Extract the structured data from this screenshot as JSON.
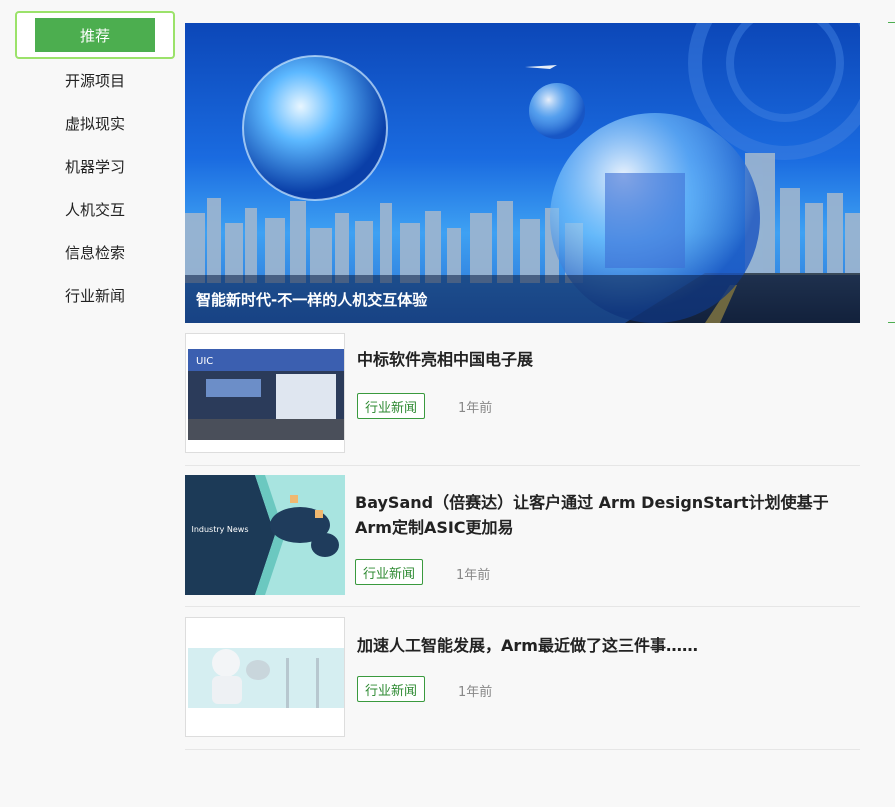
{
  "sidebar": {
    "active": "推荐",
    "items": [
      "开源项目",
      "虚拟现实",
      "机器学习",
      "人机交互",
      "信息检索",
      "行业新闻"
    ]
  },
  "banner": {
    "caption": "智能新时代-不一样的人机交互体验"
  },
  "thumbs": {
    "industry_news": "Industry News",
    "booth_logo": "UIC"
  },
  "news": [
    {
      "title": "中标软件亮相中国电子展",
      "tag": "行业新闻",
      "time": "1年前"
    },
    {
      "title": "BaySand（倍赛达）让客户通过 Arm DesignStart计划使基于Arm定制ASIC更加易",
      "tag": "行业新闻",
      "time": "1年前"
    },
    {
      "title": "加速人工智能发展，Arm最近做了这三件事……",
      "tag": "行业新闻",
      "time": "1年前"
    }
  ],
  "colors": {
    "accent": "#4cae4f",
    "tag_border": "#3a9a3e",
    "active_border": "#9be26a"
  }
}
